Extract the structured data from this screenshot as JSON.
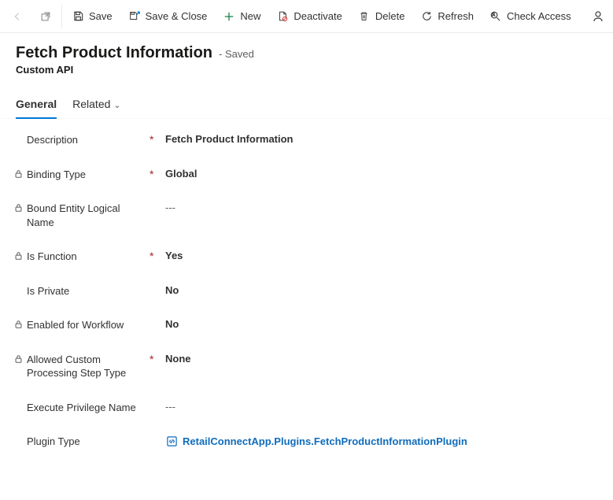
{
  "commands": {
    "save": "Save",
    "save_close": "Save & Close",
    "new": "New",
    "deactivate": "Deactivate",
    "delete": "Delete",
    "refresh": "Refresh",
    "check_access": "Check Access"
  },
  "header": {
    "title": "Fetch Product Information",
    "status": "- Saved",
    "entity_type": "Custom API"
  },
  "tabs": {
    "general": "General",
    "related": "Related"
  },
  "fields": {
    "description": {
      "label": "Description",
      "value": "Fetch Product Information",
      "required": true,
      "locked": false
    },
    "binding_type": {
      "label": "Binding Type",
      "value": "Global",
      "required": true,
      "locked": true
    },
    "bound_entity": {
      "label": "Bound Entity Logical Name",
      "value": "---",
      "required": false,
      "locked": true,
      "placeholder": true
    },
    "is_function": {
      "label": "Is Function",
      "value": "Yes",
      "required": true,
      "locked": true
    },
    "is_private": {
      "label": "Is Private",
      "value": "No",
      "required": false,
      "locked": false
    },
    "enabled_workflow": {
      "label": "Enabled for Workflow",
      "value": "No",
      "required": false,
      "locked": true
    },
    "allowed_step": {
      "label": "Allowed Custom Processing Step Type",
      "value": "None",
      "required": true,
      "locked": true
    },
    "exec_priv": {
      "label": "Execute Privilege Name",
      "value": "---",
      "required": false,
      "locked": false,
      "placeholder": true
    },
    "plugin_type": {
      "label": "Plugin Type",
      "value": "RetailConnectApp.Plugins.FetchProductInformationPlugin",
      "required": false,
      "locked": false,
      "link": true
    }
  }
}
